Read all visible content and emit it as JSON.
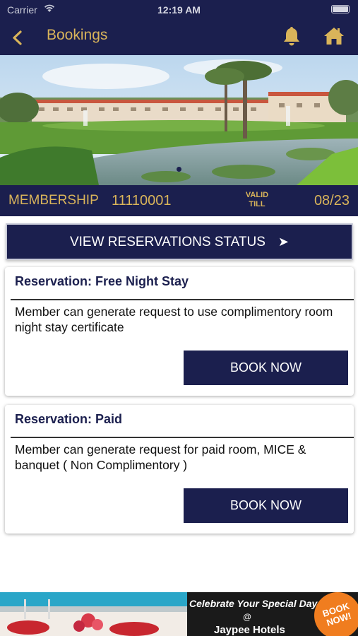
{
  "status_bar": {
    "carrier": "Carrier",
    "time": "12:19 AM"
  },
  "nav": {
    "title": "Bookings"
  },
  "membership": {
    "label": "MEMBERSHIP",
    "number": "11110001",
    "valid_label": "VALID TILL",
    "valid_date": "08/23"
  },
  "reservations_status_button": {
    "label": "VIEW RESERVATIONS STATUS"
  },
  "cards": [
    {
      "title": "Reservation: Free Night Stay",
      "description": "Member can generate request to use complimentory room night stay certificate",
      "button": "BOOK NOW"
    },
    {
      "title": "Reservation: Paid",
      "description": "Member can generate request for paid room, MICE & banquet ( Non Complimentory )",
      "button": "BOOK NOW"
    }
  ],
  "ad": {
    "line1": "Celebrate Your Special Day",
    "line2": "@",
    "line3": "Jaypee Hotels",
    "badge": "BOOK NOW!"
  },
  "colors": {
    "navy": "#1b1f4e",
    "gold": "#d9b45a"
  },
  "icons": [
    "back-arrow-icon",
    "bell-icon",
    "home-icon",
    "wifi-icon",
    "battery-icon",
    "arrow-right-icon"
  ]
}
